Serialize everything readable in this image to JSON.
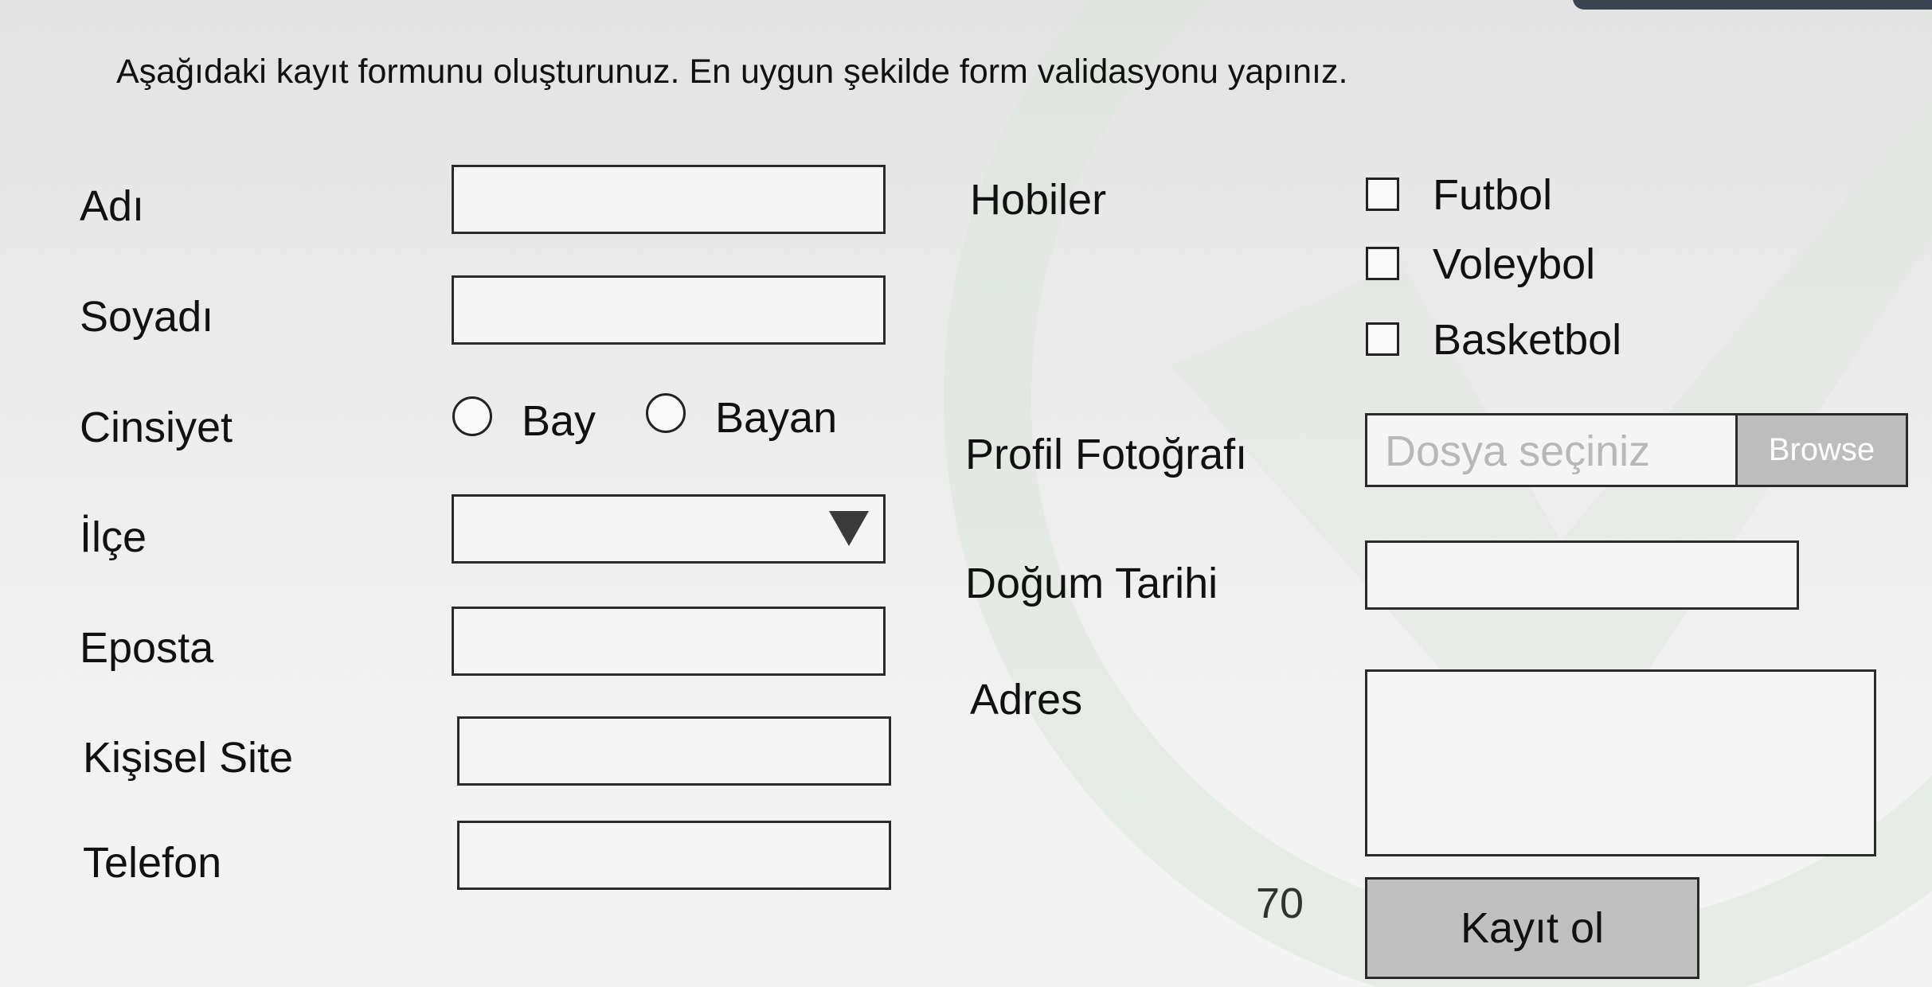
{
  "instruction": "Aşağıdaki kayıt formunu oluşturunuz. En uygun şekilde form validasyonu yapınız.",
  "form": {
    "left": {
      "first_name_label": "Adı",
      "last_name_label": "Soyadı",
      "gender_label": "Cinsiyet",
      "gender_options": [
        "Bay",
        "Bayan"
      ],
      "district_label": "İlçe",
      "district_value": "",
      "email_label": "Eposta",
      "website_label": "Kişisel Site",
      "phone_label": "Telefon"
    },
    "right": {
      "hobbies_label": "Hobiler",
      "hobbies": [
        "Futbol",
        "Voleybol",
        "Basketbol"
      ],
      "photo_label": "Profil Fotoğrafı",
      "photo_placeholder": "Dosya seçiniz",
      "browse_label": "Browse",
      "birthdate_label": "Doğum Tarihi",
      "address_label": "Adres",
      "submit_label": "Kayıt ol"
    }
  },
  "slide_number": "70",
  "icons": {
    "dropdown": "triangle-down-icon",
    "radio": "radio-empty-icon",
    "checkbox": "checkbox-empty-icon"
  },
  "colors": {
    "background": "#ececec",
    "field_border": "#2a2a2a",
    "button_bg": "#c0c0c0",
    "placeholder": "#b8b8b8"
  }
}
